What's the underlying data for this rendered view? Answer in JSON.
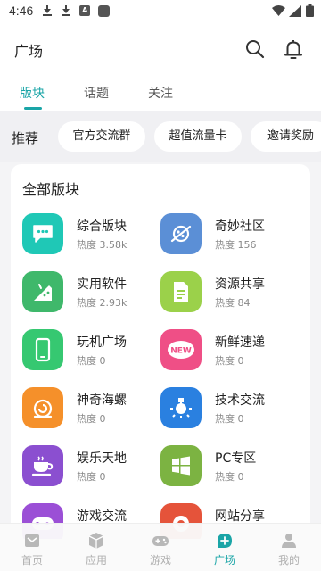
{
  "status_bar": {
    "time": "4:46"
  },
  "header": {
    "title": "广场"
  },
  "tabs": [
    {
      "label": "版块",
      "active": true
    },
    {
      "label": "话题",
      "active": false
    },
    {
      "label": "关注",
      "active": false
    }
  ],
  "recommend": {
    "label": "推荐",
    "chips": [
      "官方交流群",
      "超值流量卡",
      "邀请奖励"
    ]
  },
  "all_blocks": {
    "title": "全部版块",
    "items": [
      {
        "name": "综合版块",
        "heat": "热度 3.58k",
        "icon": "chat-bubble-icon",
        "color": "#1fc8b6"
      },
      {
        "name": "奇妙社区",
        "heat": "热度 156",
        "icon": "planet-icon",
        "color": "#5b8fd6"
      },
      {
        "name": "实用软件",
        "heat": "热度 2.93k",
        "icon": "android-icon",
        "color": "#3fb86b"
      },
      {
        "name": "资源共享",
        "heat": "热度 84",
        "icon": "document-icon",
        "color": "#9bd14a"
      },
      {
        "name": "玩机广场",
        "heat": "热度 0",
        "icon": "phone-icon",
        "color": "#36c871"
      },
      {
        "name": "新鲜速递",
        "heat": "热度 0",
        "icon": "new-badge-icon",
        "color": "#ef4f86"
      },
      {
        "name": "神奇海螺",
        "heat": "热度 0",
        "icon": "conch-shell-icon",
        "color": "#f5902a"
      },
      {
        "name": "技术交流",
        "heat": "热度 0",
        "icon": "lightbulb-icon",
        "color": "#2a80e0"
      },
      {
        "name": "娱乐天地",
        "heat": "热度 0",
        "icon": "coffee-cup-icon",
        "color": "#8b4fd0"
      },
      {
        "name": "PC专区",
        "heat": "热度 0",
        "icon": "windows-icon",
        "color": "#7cb342"
      },
      {
        "name": "游戏交流",
        "heat": "",
        "icon": "gamepad-icon",
        "color": "#9b4fd6"
      },
      {
        "name": "网站分享",
        "heat": "",
        "icon": "browser-icon",
        "color": "#e5533a"
      }
    ]
  },
  "bottom_nav": [
    {
      "label": "首页",
      "icon": "home-icon",
      "active": false
    },
    {
      "label": "应用",
      "icon": "cube-icon",
      "active": false
    },
    {
      "label": "游戏",
      "icon": "gamepad-icon",
      "active": false
    },
    {
      "label": "广场",
      "icon": "square-chat-icon",
      "active": true
    },
    {
      "label": "我的",
      "icon": "profile-icon",
      "active": false
    }
  ],
  "colors": {
    "accent": "#1aa5a7",
    "background": "#f4f4f6",
    "inactive_nav": "#b0b0b0"
  }
}
